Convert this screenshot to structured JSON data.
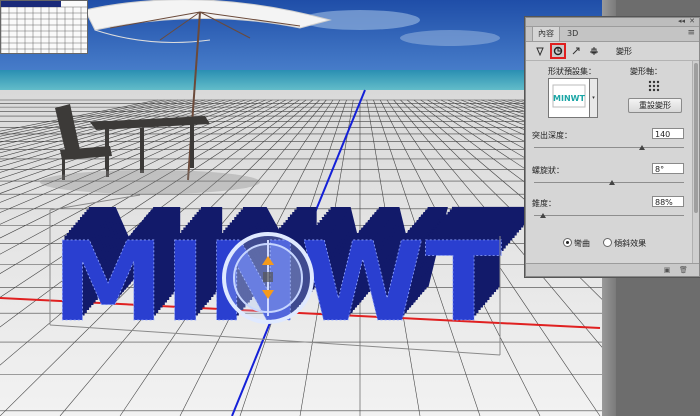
{
  "panel": {
    "tabs": [
      {
        "label": "內容",
        "active": true
      },
      {
        "label": "3D",
        "active": false
      }
    ],
    "collapse_glyph": "◂◂",
    "close_glyph": "✕",
    "menu_glyph": "≡",
    "tools": [
      {
        "icon": "mesh-icon"
      },
      {
        "icon": "deform-icon",
        "selected": true
      },
      {
        "icon": "cap-icon"
      },
      {
        "icon": "coordinates-icon"
      }
    ],
    "tool_label": "變形",
    "preset_label": "形狀預設集：",
    "contour_label": "變形軸：",
    "reset_button": "重設變形",
    "preset_text": "MINWT",
    "fields": {
      "extrusion_depth": {
        "label": "突出深度：",
        "value": "140",
        "slider": 0.72
      },
      "twist": {
        "label": "螺旋狀：",
        "value": "8°",
        "slider": 0.52
      },
      "taper": {
        "label": "錐度：",
        "value": "88%",
        "slider": 0.06
      }
    },
    "radio_bend": "彎曲",
    "radio_shear": "傾斜效果",
    "colors": {
      "selected_outline": "#e01f1f",
      "panel_bg": "#d6d6d6"
    }
  },
  "scene": {
    "text_3d": "MINWT",
    "colors": {
      "extrusion_front": "#2a3fd0",
      "extrusion_side": "#121a6a",
      "sky": "#2a5fb5",
      "sea": "#3fb6c4",
      "ground": "#e9e9e9",
      "grid": "#222222",
      "axis_red": "#e02020",
      "axis_blue": "#1420d8"
    }
  }
}
